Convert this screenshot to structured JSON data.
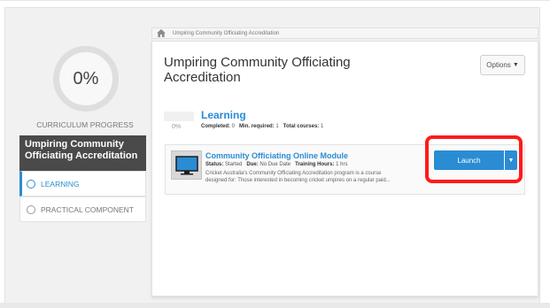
{
  "curriculum": {
    "progress_value": "0%",
    "progress_label": "CURRICULUM PROGRESS",
    "title": "Umpiring Community Officiating Accreditation",
    "sections": [
      {
        "label": "LEARNING",
        "active": true
      },
      {
        "label": "PRACTICAL COMPONENT",
        "active": false
      }
    ]
  },
  "breadcrumb": {
    "icon": "home-icon",
    "text": "Umpiring Community Officiating Accreditation"
  },
  "panel": {
    "title": "Umpiring Community Officiating Accreditation",
    "options_label": "Options"
  },
  "learning": {
    "heading": "Learning",
    "percent": "0%",
    "completed_label": "Completed:",
    "completed_value": "0",
    "min_required_label": "Min. required:",
    "min_required_value": "1",
    "total_courses_label": "Total courses:",
    "total_courses_value": "1"
  },
  "module": {
    "icon": "monitor-icon",
    "title": "Community Officiating Online Module",
    "status_label": "Status:",
    "status_value": "Started",
    "due_label": "Due:",
    "due_value": "No Due Date",
    "training_hours_label": "Training Hours:",
    "training_hours_value": "1 hrs",
    "description_line1": "Cricket Australia's Community Officiating Accreditation program is a course",
    "description_line2": "designed for: Those interested in becoming cricket umpires on a regular paid...",
    "launch_label": "Launch"
  },
  "colors": {
    "accent": "#2a8cd3",
    "sidebar_title_bg": "#4a4a4a",
    "highlight": "#ff1a1a"
  }
}
